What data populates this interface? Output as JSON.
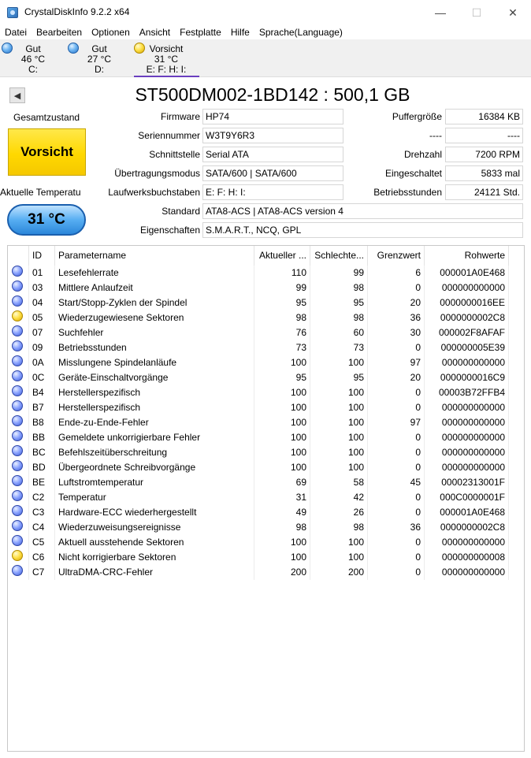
{
  "window": {
    "title": "CrystalDiskInfo 9.2.2 x64"
  },
  "menu": [
    "Datei",
    "Bearbeiten",
    "Optionen",
    "Ansicht",
    "Festplatte",
    "Hilfe",
    "Sprache(Language)"
  ],
  "drives": [
    {
      "status": "Gut",
      "temp": "46 °C",
      "letters": "C:",
      "dot": "blue"
    },
    {
      "status": "Gut",
      "temp": "27 °C",
      "letters": "D:",
      "dot": "blue"
    },
    {
      "status": "Vorsicht",
      "temp": "31 °C",
      "letters": "E: F: H: I:",
      "dot": "yellow"
    }
  ],
  "disk": {
    "model": "ST500DM002-1BD142 : 500,1 GB",
    "health_label": "Gesamtzustand",
    "health_value": "Vorsicht",
    "temp_label": "Aktuelle Temperatu",
    "temp_value": "31 °C",
    "firmware_label": "Firmware",
    "firmware": "HP74",
    "serial_label": "Seriennummer",
    "serial": "W3T9Y6R3",
    "interface_label": "Schnittstelle",
    "interface": "Serial ATA",
    "transfer_label": "Übertragungsmodus",
    "transfer": "SATA/600 | SATA/600",
    "letters_label": "Laufwerksbuchstaben",
    "letters": "E: F: H: I:",
    "standard_label": "Standard",
    "standard": "ATA8-ACS | ATA8-ACS version 4",
    "features_label": "Eigenschaften",
    "features": "S.M.A.R.T., NCQ, GPL",
    "buffer_label": "Puffergröße",
    "buffer": "16384 KB",
    "blank1_label": "----",
    "blank1": "----",
    "rpm_label": "Drehzahl",
    "rpm": "7200 RPM",
    "poweron_count_label": "Eingeschaltet",
    "poweron_count": "5833 mal",
    "poweron_hours_label": "Betriebsstunden",
    "poweron_hours": "24121 Std."
  },
  "colors": {
    "good": "#4f9be8",
    "caution": "#ffd800",
    "accent": "#6a3fbf"
  },
  "table": {
    "headers": [
      "",
      "ID",
      "Parametername",
      "Aktueller ...",
      "Schlechte...",
      "Grenzwert",
      "Rohwerte"
    ],
    "rows": [
      {
        "dot": "blue",
        "id": "01",
        "name": "Lesefehlerrate",
        "cur": "110",
        "worst": "99",
        "thr": "6",
        "raw": "000001A0E468"
      },
      {
        "dot": "blue",
        "id": "03",
        "name": "Mittlere Anlaufzeit",
        "cur": "99",
        "worst": "98",
        "thr": "0",
        "raw": "000000000000"
      },
      {
        "dot": "blue",
        "id": "04",
        "name": "Start/Stopp-Zyklen der Spindel",
        "cur": "95",
        "worst": "95",
        "thr": "20",
        "raw": "0000000016EE"
      },
      {
        "dot": "yellow",
        "id": "05",
        "name": "Wiederzugewiesene Sektoren",
        "cur": "98",
        "worst": "98",
        "thr": "36",
        "raw": "0000000002C8"
      },
      {
        "dot": "blue",
        "id": "07",
        "name": "Suchfehler",
        "cur": "76",
        "worst": "60",
        "thr": "30",
        "raw": "000002F8AFAF"
      },
      {
        "dot": "blue",
        "id": "09",
        "name": "Betriebsstunden",
        "cur": "73",
        "worst": "73",
        "thr": "0",
        "raw": "000000005E39"
      },
      {
        "dot": "blue",
        "id": "0A",
        "name": "Misslungene Spindelanläufe",
        "cur": "100",
        "worst": "100",
        "thr": "97",
        "raw": "000000000000"
      },
      {
        "dot": "blue",
        "id": "0C",
        "name": "Geräte-Einschaltvorgänge",
        "cur": "95",
        "worst": "95",
        "thr": "20",
        "raw": "0000000016C9"
      },
      {
        "dot": "blue",
        "id": "B4",
        "name": "Herstellerspezifisch",
        "cur": "100",
        "worst": "100",
        "thr": "0",
        "raw": "00003B72FFB4"
      },
      {
        "dot": "blue",
        "id": "B7",
        "name": "Herstellerspezifisch",
        "cur": "100",
        "worst": "100",
        "thr": "0",
        "raw": "000000000000"
      },
      {
        "dot": "blue",
        "id": "B8",
        "name": "Ende-zu-Ende-Fehler",
        "cur": "100",
        "worst": "100",
        "thr": "97",
        "raw": "000000000000"
      },
      {
        "dot": "blue",
        "id": "BB",
        "name": "Gemeldete unkorrigierbare Fehler",
        "cur": "100",
        "worst": "100",
        "thr": "0",
        "raw": "000000000000"
      },
      {
        "dot": "blue",
        "id": "BC",
        "name": "Befehlszeitüberschreitung",
        "cur": "100",
        "worst": "100",
        "thr": "0",
        "raw": "000000000000"
      },
      {
        "dot": "blue",
        "id": "BD",
        "name": "Übergeordnete Schreibvorgänge",
        "cur": "100",
        "worst": "100",
        "thr": "0",
        "raw": "000000000000"
      },
      {
        "dot": "blue",
        "id": "BE",
        "name": "Luftstromtemperatur",
        "cur": "69",
        "worst": "58",
        "thr": "45",
        "raw": "00002313001F"
      },
      {
        "dot": "blue",
        "id": "C2",
        "name": "Temperatur",
        "cur": "31",
        "worst": "42",
        "thr": "0",
        "raw": "000C0000001F"
      },
      {
        "dot": "blue",
        "id": "C3",
        "name": "Hardware-ECC wiederhergestellt",
        "cur": "49",
        "worst": "26",
        "thr": "0",
        "raw": "000001A0E468"
      },
      {
        "dot": "blue",
        "id": "C4",
        "name": "Wiederzuweisungsereignisse",
        "cur": "98",
        "worst": "98",
        "thr": "36",
        "raw": "0000000002C8"
      },
      {
        "dot": "blue",
        "id": "C5",
        "name": "Aktuell ausstehende Sektoren",
        "cur": "100",
        "worst": "100",
        "thr": "0",
        "raw": "000000000000"
      },
      {
        "dot": "yellow",
        "id": "C6",
        "name": "Nicht korrigierbare Sektoren",
        "cur": "100",
        "worst": "100",
        "thr": "0",
        "raw": "000000000008"
      },
      {
        "dot": "blue",
        "id": "C7",
        "name": "UltraDMA-CRC-Fehler",
        "cur": "200",
        "worst": "200",
        "thr": "0",
        "raw": "000000000000"
      }
    ]
  }
}
